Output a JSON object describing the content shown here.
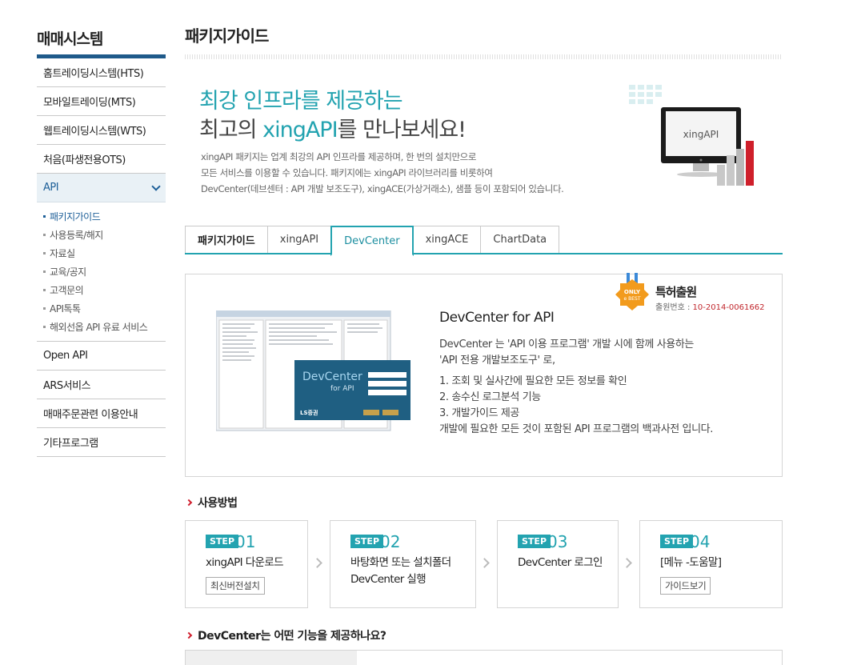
{
  "sidebar": {
    "title": "매매시스템",
    "items_top": [
      {
        "label": "홈트레이딩시스템(HTS)"
      },
      {
        "label": "모바일트레이딩(MTS)"
      },
      {
        "label": "웹트레이딩시스템(WTS)"
      },
      {
        "label": "처음(파생전용OTS)"
      }
    ],
    "active_item": {
      "label": "API"
    },
    "sub_items": [
      {
        "label": "패키지가이드"
      },
      {
        "label": "사용등록/해지"
      },
      {
        "label": "자료실"
      },
      {
        "label": "교육/공지"
      },
      {
        "label": "고객문의"
      },
      {
        "label": "API톡톡"
      },
      {
        "label": "해외선옵 API 유료 서비스"
      }
    ],
    "items_bottom": [
      {
        "label": "Open API"
      },
      {
        "label": "ARS서비스"
      },
      {
        "label": "매매주문관련 이용안내"
      },
      {
        "label": "기타프로그램"
      }
    ]
  },
  "page": {
    "title": "패키지가이드"
  },
  "hero": {
    "line1": "최강 인프라를 제공하는",
    "line2_pre": "최고의 ",
    "line2_hl": "xingAPI",
    "line2_post": "를 만나보세요!",
    "desc1": "xingAPI 패키지는 업계 최강의 API 인프라를 제공하며, 한 번의 설치만으로",
    "desc2": "모든 서비스를 이용할 수 있습니다.  패키지에는 xingAPI 라이브러리를 비롯하여",
    "desc3": "DevCenter(데브센터 : API 개발 보조도구), xingACE(가상거래소), 샘플 등이 포함되어 있습니다.",
    "monitor_label": "xingAPI"
  },
  "tabs": [
    {
      "label": "패키지가이드"
    },
    {
      "label": "xingAPI"
    },
    {
      "label": "DevCenter"
    },
    {
      "label": "xingACE"
    },
    {
      "label": "ChartData"
    }
  ],
  "devcenter": {
    "badge_line1": "ONLY",
    "badge_line2": "e BEST",
    "patent_title": "특허출원",
    "patent_no_label": "출원번호 : ",
    "patent_no": "10-2014-0061662",
    "shot_title": "DevCenter",
    "shot_sub": "for API",
    "shot_logo": "LS증권",
    "title": "DevCenter for API",
    "text1": "DevCenter 는 'API 이용 프로그램' 개발 시에 함께 사용하는",
    "text2": "'API 전용 개발보조도구' 로,",
    "list1": "1. 조회 및 실사간에 필요한 모든 정보를 확인",
    "list2": "2. 송수신 로그분석 기능",
    "list3": "3. 개발가이드 제공",
    "text3": "개발에 필요한 모든 것이 포함된 API 프로그램의 백과사전 입니다."
  },
  "usage": {
    "heading": "사용방법",
    "steps": [
      {
        "badge": "STEP",
        "num": "01",
        "line1": "xingAPI 다운로드",
        "line2": "",
        "button": "최신버전설치"
      },
      {
        "badge": "STEP",
        "num": "02",
        "line1": "바탕화면 또는 설치폴더",
        "line2": "DevCenter 실행",
        "button": ""
      },
      {
        "badge": "STEP",
        "num": "03",
        "line1": "DevCenter 로그인",
        "line2": "",
        "button": ""
      },
      {
        "badge": "STEP",
        "num": "04",
        "line1": "[메뉴 -도움말]",
        "line2": "",
        "button": "가이드보기"
      }
    ]
  },
  "features": {
    "heading": "DevCenter는 어떤 기능을 제공하나요?"
  },
  "colors": {
    "accent": "#23a3b0",
    "nav_blue": "#1f5a8a",
    "red": "#d01d2c"
  }
}
